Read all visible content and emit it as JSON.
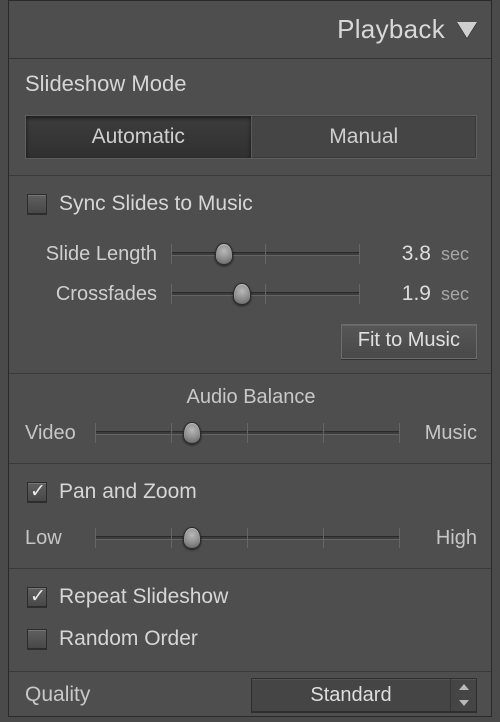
{
  "panel": {
    "title": "Playback"
  },
  "mode": {
    "heading": "Slideshow Mode",
    "options": [
      "Automatic",
      "Manual"
    ],
    "active": 0
  },
  "sync": {
    "label": "Sync Slides to Music",
    "checked": false
  },
  "slide_length": {
    "label": "Slide Length",
    "value": "3.8",
    "unit": "sec",
    "pos": 28
  },
  "crossfades": {
    "label": "Crossfades",
    "value": "1.9",
    "unit": "sec",
    "pos": 38
  },
  "fit_button": "Fit to Music",
  "audio_balance": {
    "heading": "Audio Balance",
    "left": "Video",
    "right": "Music",
    "pos": 32
  },
  "pan_zoom": {
    "label": "Pan and Zoom",
    "checked": true,
    "left": "Low",
    "right": "High",
    "pos": 32
  },
  "repeat": {
    "label": "Repeat Slideshow",
    "checked": true
  },
  "random": {
    "label": "Random Order",
    "checked": false
  },
  "quality": {
    "label": "Quality",
    "value": "Standard"
  }
}
